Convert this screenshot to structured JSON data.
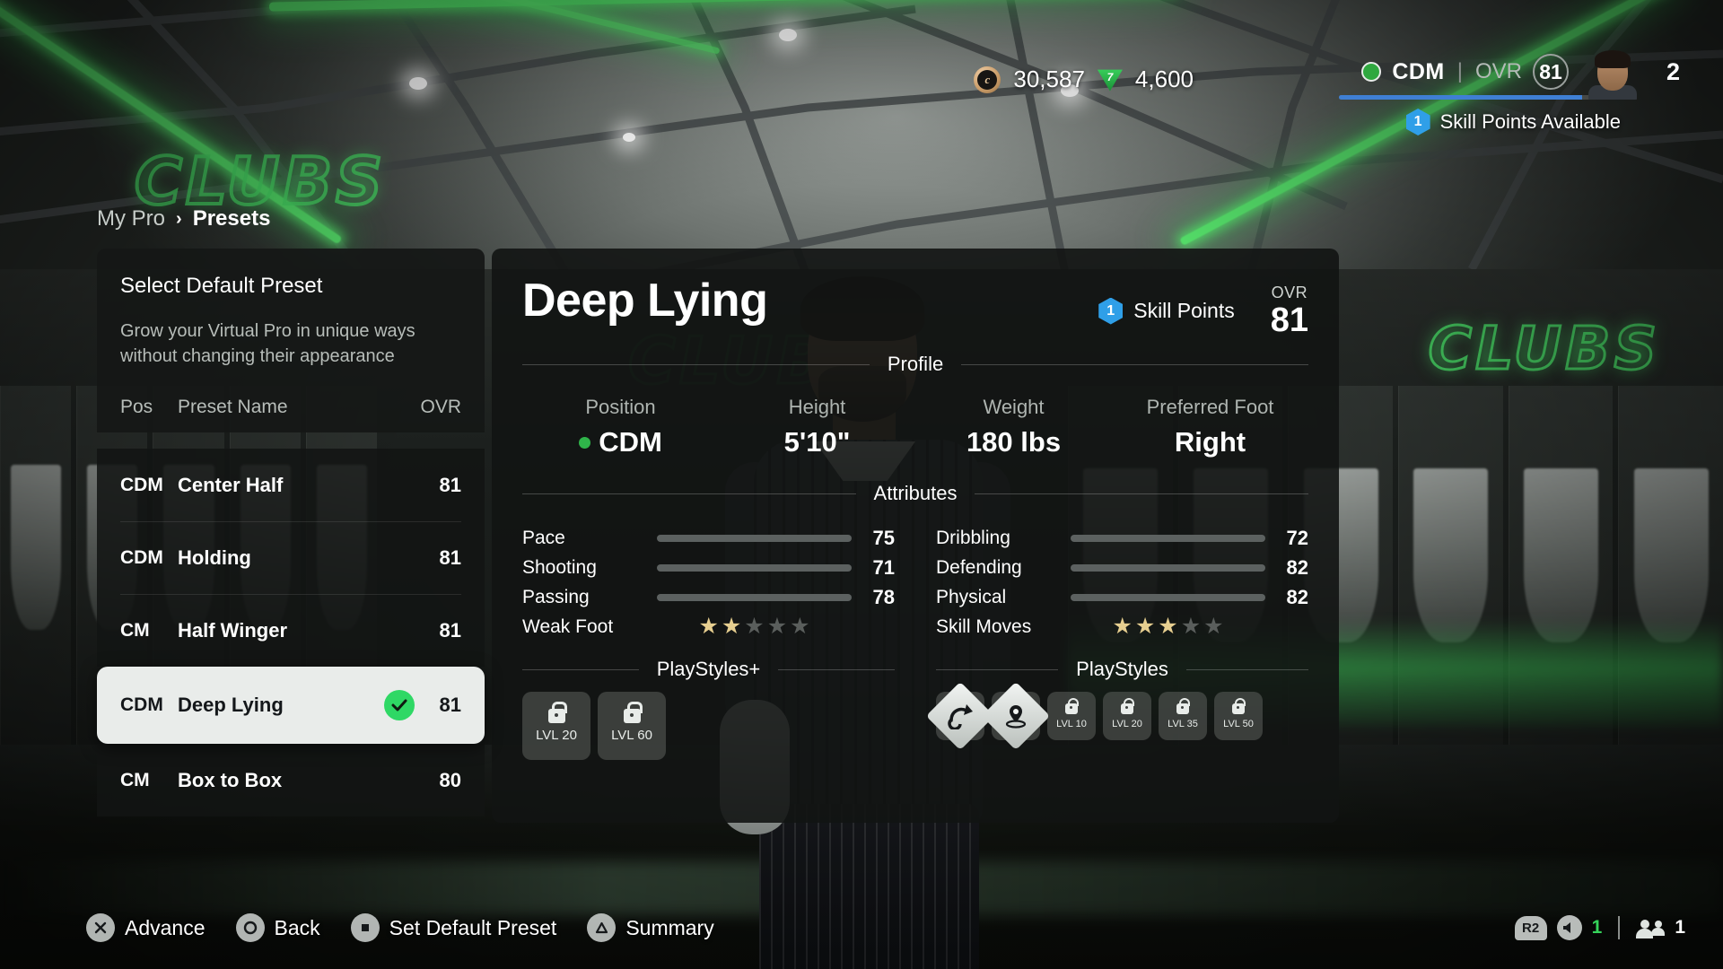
{
  "hud": {
    "currency": [
      {
        "icon": "coin-icon",
        "value": "30,587"
      },
      {
        "icon": "gem-icon",
        "value": "4,600"
      }
    ],
    "player": {
      "position": "CDM",
      "divider": "|",
      "ovr_label": "OVR",
      "ovr_value": "81",
      "level": "2",
      "skill_points_count": "1",
      "skill_points_label": "Skill Points Available"
    }
  },
  "breadcrumb": {
    "parent": "My Pro",
    "separator": "›",
    "current": "Presets"
  },
  "left_panel": {
    "title": "Select Default Preset",
    "description": "Grow your Virtual Pro in unique ways without changing their appearance",
    "columns": {
      "pos": "Pos",
      "name": "Preset Name",
      "ovr": "OVR"
    },
    "presets": [
      {
        "pos": "CDM",
        "name": "Center Half",
        "ovr": "81",
        "selected": false
      },
      {
        "pos": "CDM",
        "name": "Holding",
        "ovr": "81",
        "selected": false
      },
      {
        "pos": "CM",
        "name": "Half Winger",
        "ovr": "81",
        "selected": false
      },
      {
        "pos": "CDM",
        "name": "Deep Lying",
        "ovr": "81",
        "selected": true
      },
      {
        "pos": "CM",
        "name": "Box to Box",
        "ovr": "80",
        "selected": false
      }
    ]
  },
  "detail": {
    "title": "Deep Lying",
    "skill_points_count": "1",
    "skill_points_label": "Skill Points",
    "ovr_label": "OVR",
    "ovr_value": "81",
    "profile_section_title": "Profile",
    "profile": [
      {
        "label": "Position",
        "value": "CDM",
        "has_dot": true
      },
      {
        "label": "Height",
        "value": "5'10\"",
        "has_dot": false
      },
      {
        "label": "Weight",
        "value": "180 lbs",
        "has_dot": false
      },
      {
        "label": "Preferred Foot",
        "value": "Right",
        "has_dot": false
      }
    ],
    "attributes_section_title": "Attributes",
    "attributes_left": [
      {
        "label": "Pace",
        "value": "75"
      },
      {
        "label": "Shooting",
        "value": "71"
      },
      {
        "label": "Passing",
        "value": "78"
      }
    ],
    "attributes_right": [
      {
        "label": "Dribbling",
        "value": "72"
      },
      {
        "label": "Defending",
        "value": "82"
      },
      {
        "label": "Physical",
        "value": "82"
      }
    ],
    "weak_foot": {
      "label": "Weak Foot",
      "filled": 2,
      "total": 5
    },
    "skill_moves": {
      "label": "Skill Moves",
      "filled": 3,
      "total": 5
    },
    "playstyles_plus": {
      "title": "PlayStyles+",
      "tiles": [
        {
          "locked": true,
          "level": "LVL 20",
          "icon": "lock-icon"
        },
        {
          "locked": true,
          "level": "LVL 60",
          "icon": "lock-icon"
        }
      ]
    },
    "playstyles": {
      "title": "PlayStyles",
      "tiles": [
        {
          "locked": false,
          "level": "",
          "icon": "pinged-pass-icon"
        },
        {
          "locked": false,
          "level": "",
          "icon": "intercept-icon"
        },
        {
          "locked": true,
          "level": "LVL 10",
          "icon": "lock-icon"
        },
        {
          "locked": true,
          "level": "LVL 20",
          "icon": "lock-icon"
        },
        {
          "locked": true,
          "level": "LVL 35",
          "icon": "lock-icon"
        },
        {
          "locked": true,
          "level": "LVL 50",
          "icon": "lock-icon"
        }
      ]
    }
  },
  "bottom_bar": {
    "actions": [
      {
        "glyph": "cross-button-icon",
        "label": "Advance"
      },
      {
        "glyph": "circle-button-icon",
        "label": "Back"
      },
      {
        "glyph": "square-button-icon",
        "label": "Set Default Preset"
      },
      {
        "glyph": "triangle-button-icon",
        "label": "Summary"
      }
    ],
    "status": {
      "r2_key": "R2",
      "volume_value": "1",
      "party_value": "1"
    }
  },
  "scene": {
    "wall_text_right": "CLUBS",
    "wall_text_left": "CLUBS",
    "wall_text_center": "CLUBS"
  },
  "colors": {
    "accent_green": "#2fd865",
    "accent_blue": "#2e8ae6",
    "neon_green": "#55e06a",
    "star_gold": "#e7cf90",
    "panel_bg": "#121413",
    "selected_row_bg": "#e9ecea"
  }
}
